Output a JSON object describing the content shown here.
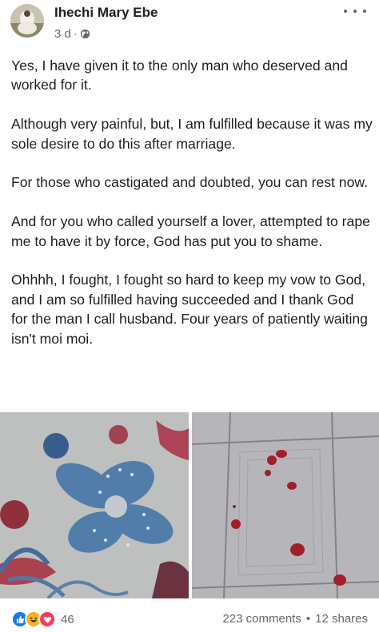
{
  "post": {
    "author": "Ihechi Mary Ebe",
    "time": "3 d",
    "privacy_icon": "globe-icon",
    "menu_icon": "more-horizontal-icon",
    "paragraphs": [
      "Yes, I have given it to the only man who deserved and worked for it.",
      "Although very painful, but, I am fulfilled because it was my sole desire to do this after marriage.",
      "For those who castigated and doubted, you can rest now.",
      "And for you who called yourself a lover, attempted to rape me to have it by force, God has put you to shame.",
      "Ohhhh, I fought, I fought so hard to keep my vow to God, and I am so fulfilled having succeeded and I thank God for the man I call husband. Four years of patiently waiting isn't moi moi."
    ]
  },
  "photos": {
    "left_icon": "floral-bedsheet-photo",
    "right_icon": "tiled-floor-blood-photo"
  },
  "footer": {
    "reaction_icons": [
      "like-icon",
      "haha-icon",
      "love-icon"
    ],
    "reaction_count": "46",
    "comments": "223 comments",
    "separator": "•",
    "shares": "12 shares"
  },
  "colors": {
    "text": "#1c1e21",
    "secondary": "#65676b",
    "like": "#1877f2",
    "haha": "#f7b125",
    "love": "#f33e58"
  }
}
